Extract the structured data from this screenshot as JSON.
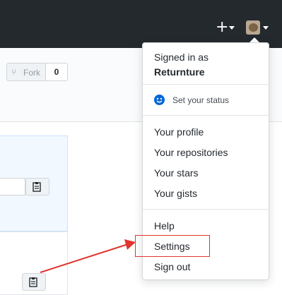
{
  "header": {
    "plus_icon": "plus-icon",
    "avatar_icon": "avatar-icon"
  },
  "repo": {
    "fork_label": "Fork",
    "fork_count": "0"
  },
  "menu": {
    "signed_in_as": "Signed in as",
    "username": "Returnture",
    "set_status": "Set your status",
    "items": [
      {
        "label": "Your profile"
      },
      {
        "label": "Your repositories"
      },
      {
        "label": "Your stars"
      },
      {
        "label": "Your gists"
      },
      {
        "label": "Help"
      },
      {
        "label": "Settings"
      },
      {
        "label": "Sign out"
      }
    ]
  },
  "annotation": {
    "highlight_color": "#e0342e",
    "highlight_target": "Settings"
  }
}
